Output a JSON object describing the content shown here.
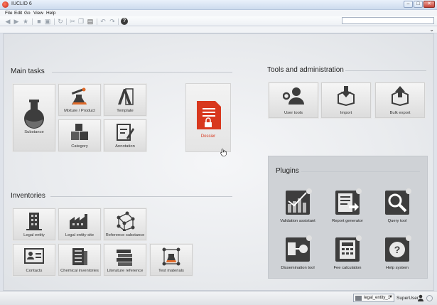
{
  "window": {
    "title": "IUCLID 6",
    "minimize": "–",
    "maximize": "□",
    "close": "✕"
  },
  "menu": [
    "File",
    "Edit",
    "Go",
    "View",
    "Help"
  ],
  "main_tasks": {
    "title": "Main tasks",
    "tiles": [
      {
        "label": "Substance",
        "icon": "flask-icon"
      },
      {
        "label": "Mixture / Product",
        "icon": "mixture-icon"
      },
      {
        "label": "Template",
        "icon": "template-icon"
      },
      {
        "label": "Category",
        "icon": "category-icon"
      },
      {
        "label": "Annotation",
        "icon": "annotation-icon"
      }
    ],
    "dossier": {
      "label": "Dossier",
      "icon": "dossier-icon",
      "color": "#d8381e"
    }
  },
  "tools": {
    "title": "Tools and administration",
    "tiles": [
      {
        "label": "User tools",
        "icon": "user-tools-icon"
      },
      {
        "label": "Import",
        "icon": "import-icon"
      },
      {
        "label": "Bulk export",
        "icon": "bulk-export-icon"
      }
    ]
  },
  "plugins": {
    "title": "Plugins",
    "items": [
      {
        "label": "Validation assistant",
        "icon": "validation-icon"
      },
      {
        "label": "Report generator",
        "icon": "report-icon"
      },
      {
        "label": "Query tool",
        "icon": "query-icon"
      },
      {
        "label": "Dissemination tool",
        "icon": "dissemination-icon"
      },
      {
        "label": "Fee calculation",
        "icon": "calculator-icon"
      },
      {
        "label": "Help system",
        "icon": "help-icon"
      }
    ]
  },
  "inventories": {
    "title": "Inventories",
    "tiles": [
      {
        "label": "Legal entity",
        "icon": "legal-entity-icon"
      },
      {
        "label": "Legal entity site",
        "icon": "factory-icon"
      },
      {
        "label": "Reference substance",
        "icon": "molecule-icon"
      },
      {
        "label": "Contacts",
        "icon": "contacts-icon"
      },
      {
        "label": "Chemical inventories",
        "icon": "inventory-icon"
      },
      {
        "label": "Literature reference",
        "icon": "books-icon"
      },
      {
        "label": "Test materials",
        "icon": "test-materials-icon"
      }
    ]
  },
  "status": {
    "legal_entity": "legal_entity_1",
    "user": "SuperUser"
  }
}
